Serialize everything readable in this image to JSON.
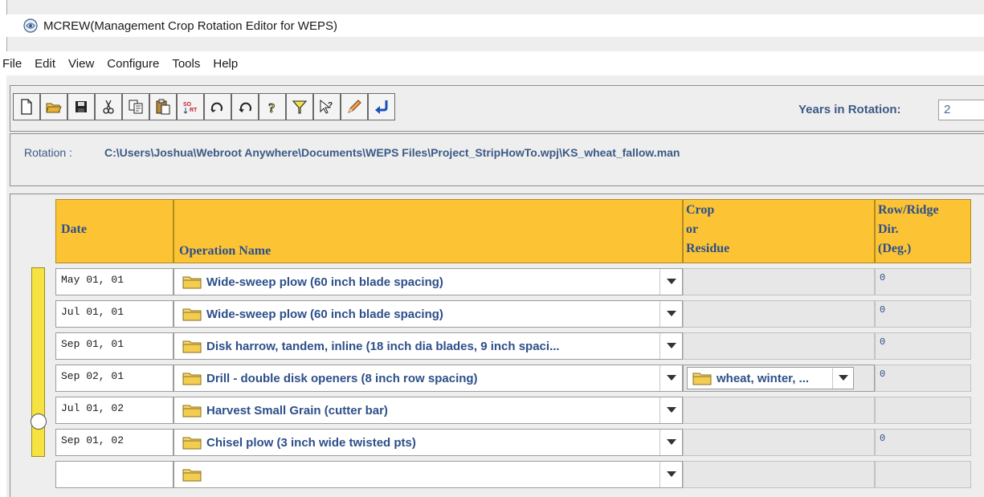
{
  "window": {
    "title": "MCREW(Management Crop Rotation Editor for WEPS)"
  },
  "menu": {
    "items": [
      "File",
      "Edit",
      "View",
      "Configure",
      "Tools",
      "Help"
    ]
  },
  "toolbar": {
    "buttons": [
      {
        "name": "new-icon"
      },
      {
        "name": "open-icon"
      },
      {
        "name": "save-icon"
      },
      {
        "name": "cut-icon"
      },
      {
        "name": "copy-icon"
      },
      {
        "name": "paste-icon"
      },
      {
        "name": "sort-icon"
      },
      {
        "name": "redo-icon"
      },
      {
        "name": "undo-icon"
      },
      {
        "name": "help-icon"
      },
      {
        "name": "filter-icon"
      },
      {
        "name": "context-help-icon"
      },
      {
        "name": "edit-pencil-icon"
      },
      {
        "name": "return-icon"
      }
    ],
    "years_label": "Years in Rotation:",
    "years_value": "2"
  },
  "rotation": {
    "label": "Rotation :",
    "path": "C:\\Users\\Joshua\\Webroot Anywhere\\Documents\\WEPS Files\\Project_StripHowTo.wpj\\KS_wheat_fallow.man"
  },
  "table": {
    "headers": {
      "date": "Date",
      "operation": "Operation Name",
      "crop_1": "Crop",
      "crop_2": "or",
      "crop_3": "Residue",
      "dir_1": "Row/Ridge",
      "dir_2": "Dir.",
      "dir_3": "(Deg.)"
    },
    "rows": [
      {
        "date": "May 01, 01",
        "operation": "Wide-sweep plow (60 inch blade spacing)",
        "crop": "",
        "dir": "0"
      },
      {
        "date": "Jul 01, 01",
        "operation": "Wide-sweep plow (60 inch blade spacing)",
        "crop": "",
        "dir": "0"
      },
      {
        "date": "Sep 01, 01",
        "operation": "Disk harrow, tandem, inline (18 inch dia blades, 9 inch spaci...",
        "crop": "",
        "dir": "0"
      },
      {
        "date": "Sep 02, 01",
        "operation": "Drill - double disk openers (8 inch row spacing)",
        "crop": "wheat, winter, ...",
        "dir": "0"
      },
      {
        "date": "Jul 01, 02",
        "operation": "Harvest Small Grain (cutter bar)",
        "crop": "",
        "dir": ""
      },
      {
        "date": "Sep 01, 02",
        "operation": "Chisel plow (3 inch wide twisted pts)",
        "crop": "",
        "dir": "0"
      },
      {
        "date": "",
        "operation": "",
        "crop": "",
        "dir": ""
      }
    ]
  },
  "colors": {
    "header_bg": "#fcc435",
    "header_text": "#2d4f8a",
    "slider": "#f6e240"
  }
}
